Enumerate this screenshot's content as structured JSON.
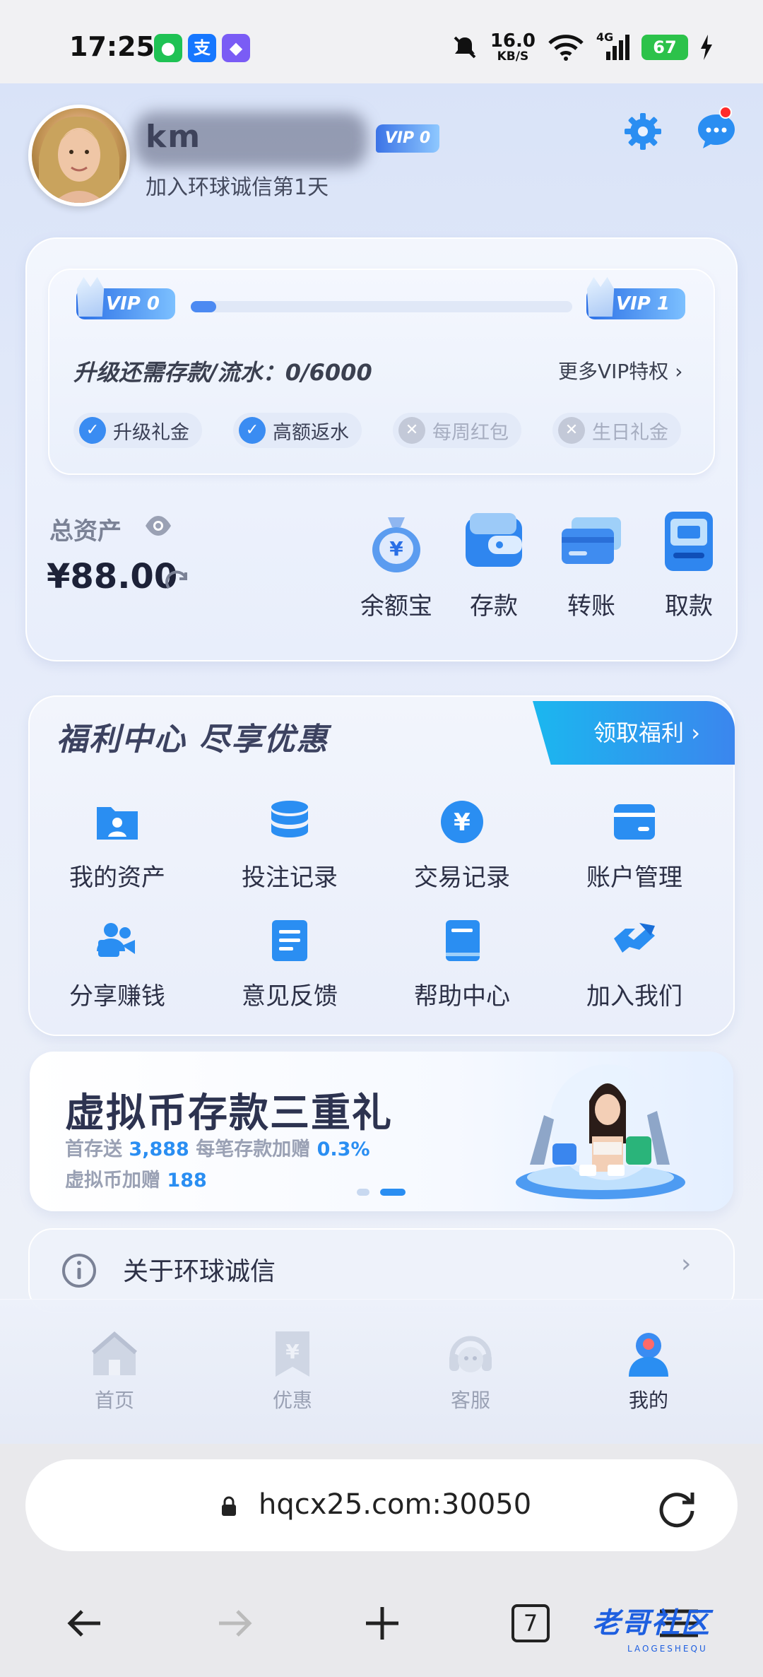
{
  "status_bar": {
    "time": "17:25",
    "speed_value": "16.0",
    "speed_unit": "KB/S",
    "network": "4G",
    "battery": "67",
    "icons": [
      "wechat-icon",
      "alipay-icon",
      "shield-app-icon",
      "mute-icon",
      "wifi-icon",
      "signal-icon",
      "charging-icon"
    ]
  },
  "header": {
    "username": "km",
    "vip_tag": "VIP 0",
    "joined": "加入环球诚信第1天"
  },
  "vip_card": {
    "current_level": "VIP 0",
    "next_level": "VIP 1",
    "progress": 0.0,
    "upgrade_text": "升级还需存款/流水：0/6000",
    "more_link": "更多VIP特权",
    "perks": [
      {
        "label": "升级礼金",
        "enabled": true
      },
      {
        "label": "高额返水",
        "enabled": true
      },
      {
        "label": "每周红包",
        "enabled": false
      },
      {
        "label": "生日礼金",
        "enabled": false
      }
    ]
  },
  "assets": {
    "label": "总资产",
    "value": "¥88.00",
    "actions": [
      "余额宝",
      "存款",
      "转账",
      "取款"
    ]
  },
  "welfare": {
    "title": "福利中心  尽享优惠",
    "claim_button": "领取福利",
    "items": [
      "我的资产",
      "投注记录",
      "交易记录",
      "账户管理",
      "分享赚钱",
      "意见反馈",
      "帮助中心",
      "加入我们"
    ]
  },
  "banner": {
    "title": "虚拟币存款三重礼",
    "line1_label": "首存送",
    "line1_value": "3,888",
    "line1_label2": "每笔存款加赠",
    "line1_value2": "0.3%",
    "line2_label": "虚拟币加赠",
    "line2_value": "188",
    "active_slide": 2,
    "slides": 2
  },
  "about": {
    "label": "关于环球诚信"
  },
  "bottom_nav": {
    "items": [
      "首页",
      "优惠",
      "客服",
      "我的"
    ],
    "active": "我的"
  },
  "browser": {
    "url": "hqcx25.com:30050",
    "tab_count": "7",
    "watermark": "老哥社区",
    "watermark_sub": "LAOGESHEQU"
  },
  "colors": {
    "accent": "#2a8ef2",
    "vip_gradient_start": "#2b6fe6",
    "title_text": "#1d2238",
    "muted_text": "#9aa1b4"
  }
}
